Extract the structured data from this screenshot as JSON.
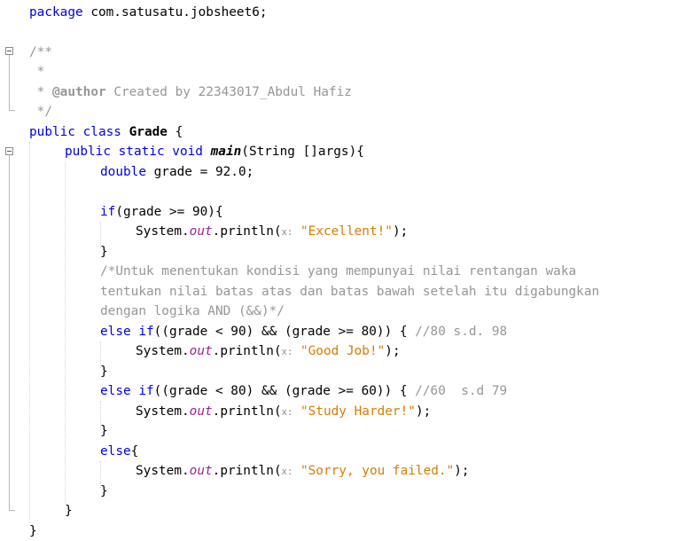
{
  "code": {
    "package_kw": "package",
    "package_name": " com.satusatu.jobsheet6;",
    "doc_open": "/**",
    "doc_star": " *",
    "doc_author_prefix": " * ",
    "doc_author_tag": "@author",
    "doc_author_text": " Created by 22343017_Abdul Hafiz",
    "doc_close": " */",
    "class_kw": "public class",
    "class_name": "Grade",
    "class_brace": " {",
    "main_mods": "public static void",
    "main_name": "main",
    "main_params": "(String []args){",
    "double_kw": "double",
    "grade_decl": " grade = 92.0;",
    "if_kw": "if",
    "if_cond": "(grade >= 90){",
    "sysout_prefix": "System.",
    "out_field": "out",
    "println": ".println(",
    "param_hint": "x:",
    "msg_excellent": "\"Excellent!\"",
    "call_end": ");",
    "close_brace": "}",
    "comment_line1": "/*Untuk menentukan kondisi yang mempunyai nilai rentangan waka",
    "comment_line2": "tentukan nilai batas atas dan batas bawah setelah itu digabungkan",
    "comment_line3": "dengan logika AND (&&)*/",
    "else_if_kw": "else if",
    "cond_80_90": "((grade < 90) && (grade >= 80)) { ",
    "comment_80": "//80 s.d. 98",
    "msg_goodjob": "\"Good Job!\"",
    "cond_60_80": "((grade < 80) && (grade >= 60)) { ",
    "comment_60": "//60  s.d 79",
    "msg_study": "\"Study Harder!\"",
    "else_kw": "else",
    "else_brace": "{",
    "msg_sorry": "\"Sorry, you failed.\""
  },
  "colors": {
    "keyword": "#0000e6",
    "comment": "#969696",
    "string": "#ce7b00",
    "field": "#9b2393"
  }
}
